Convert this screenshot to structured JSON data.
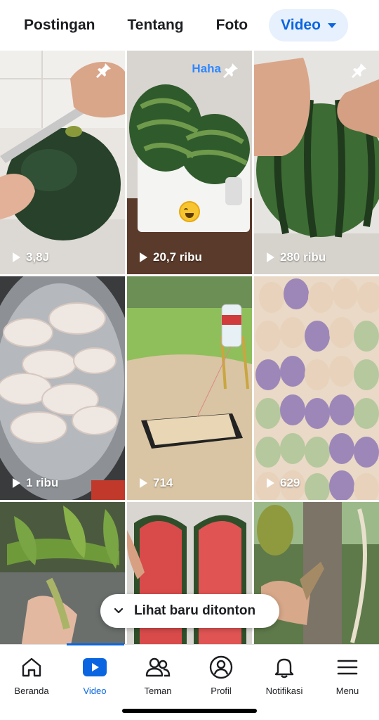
{
  "tabs": [
    {
      "label": "Postingan"
    },
    {
      "label": "Tentang"
    },
    {
      "label": "Foto"
    },
    {
      "label": "Video",
      "active": true
    }
  ],
  "videos": [
    {
      "views": "3,8J",
      "pinned": true,
      "scene": "watermelon cut by knife"
    },
    {
      "views": "20,7 ribu",
      "pinned": true,
      "reaction": "Haha",
      "scene": "two watermelons on board"
    },
    {
      "views": "280 ribu",
      "pinned": true,
      "scene": "watermelon held in hands"
    },
    {
      "views": "1 ribu",
      "scene": "raw chicken drumsticks"
    },
    {
      "views": "714",
      "scene": "bottle trap in field"
    },
    {
      "views": "629",
      "scene": "colorful dumplings"
    },
    {
      "views": "",
      "scene": "plant cutting"
    },
    {
      "views": "",
      "scene": "red watermelon halves"
    },
    {
      "views": "",
      "scene": "durian tree"
    }
  ],
  "recent_button": {
    "label": "Lihat baru ditonton"
  },
  "nav": [
    {
      "label": "Beranda",
      "icon": "home-icon"
    },
    {
      "label": "Video",
      "icon": "video-play-icon",
      "active": true
    },
    {
      "label": "Teman",
      "icon": "friends-icon"
    },
    {
      "label": "Profil",
      "icon": "profile-icon"
    },
    {
      "label": "Notifikasi",
      "icon": "bell-icon"
    },
    {
      "label": "Menu",
      "icon": "menu-icon"
    }
  ],
  "colors": {
    "accent": "#0a66e0",
    "active_tab_bg": "#e7f0fd"
  }
}
